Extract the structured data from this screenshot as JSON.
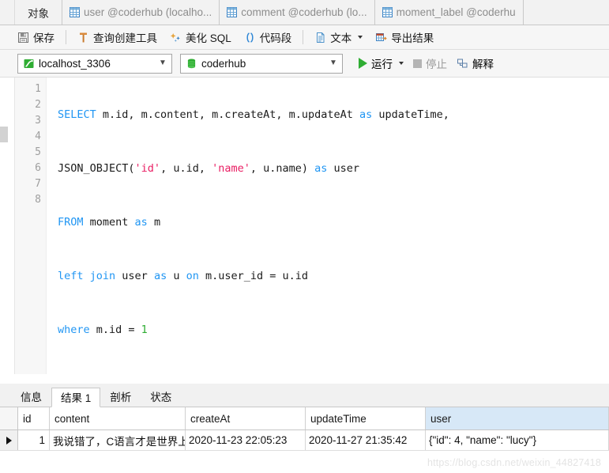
{
  "tabbar": {
    "object_label": "对象",
    "tabs": [
      {
        "icon": "table-grid-icon",
        "label": "user @coderhub (localho..."
      },
      {
        "icon": "table-grid-icon",
        "label": "comment @coderhub (lo..."
      },
      {
        "icon": "table-grid-icon",
        "label": "moment_label @coderhu"
      }
    ]
  },
  "toolbar": {
    "save_label": "保存",
    "query_builder_label": "查询创建工具",
    "beautify_label": "美化 SQL",
    "snippet_label": "代码段",
    "text_label": "文本",
    "export_label": "导出结果"
  },
  "connbar": {
    "connection_value": "localhost_3306",
    "database_value": "coderhub",
    "run_label": "运行",
    "stop_label": "停止",
    "explain_label": "解释"
  },
  "editor": {
    "line_numbers": [
      "1",
      "2",
      "3",
      "4",
      "5",
      "6",
      "7",
      "8"
    ],
    "lines": [
      {
        "n": 1,
        "text": "SELECT m.id, m.content, m.createAt, m.updateAt as updateTime,"
      },
      {
        "n": 2,
        "text": "JSON_OBJECT('id', u.id, 'name', u.name) as user"
      },
      {
        "n": 3,
        "text": "FROM moment as m"
      },
      {
        "n": 4,
        "text": "left join user as u on m.user_id = u.id"
      },
      {
        "n": 5,
        "text": "where m.id = 1"
      },
      {
        "n": 6,
        "text": ""
      },
      {
        "n": 7,
        "text": ""
      },
      {
        "n": 8,
        "text": ""
      }
    ],
    "tokens": {
      "l1_kw_select": "SELECT",
      "l1_mid": " m.id, m.content, m.createAt, m.updateAt ",
      "l1_kw_as": "as",
      "l1_end": " updateTime,",
      "l2_fn": "JSON_OBJECT(",
      "l2_s1": "'id'",
      "l2_m1": ", u.id, ",
      "l2_s2": "'name'",
      "l2_m2": ", u.name) ",
      "l2_kw_as": "as",
      "l2_end": " user",
      "l3_kw": "FROM",
      "l3_rest": " moment ",
      "l3_kw2": "as",
      "l3_end": " m",
      "l4_kw": "left join",
      "l4_m1": " user ",
      "l4_kw2": "as",
      "l4_m2": " u ",
      "l4_kw3": "on",
      "l4_end": " m.user_id = u.id",
      "l5_kw": "where",
      "l5_m": " m.id = ",
      "l5_num": "1"
    },
    "cursor_line": 8
  },
  "bottom_tabs": [
    {
      "label": "信息",
      "active": false
    },
    {
      "label": "结果 1",
      "active": true
    },
    {
      "label": "剖析",
      "active": false
    },
    {
      "label": "状态",
      "active": false
    }
  ],
  "result_grid": {
    "columns": [
      "id",
      "content",
      "createAt",
      "updateTime",
      "user"
    ],
    "selected_column": "user",
    "rows": [
      {
        "id": "1",
        "content": "我说错了，C语言才是世界上最好的语言",
        "createAt": "2020-11-23 22:05:23",
        "updateTime": "2020-11-27 21:35:42",
        "user": "{\"id\": 4, \"name\": \"lucy\"}"
      }
    ]
  },
  "watermark": "https://blog.csdn.net/weixin_44827418",
  "colors": {
    "keyword": "#2196f3",
    "string": "#e91e63",
    "number": "#2fad33",
    "run_green": "#2fad33",
    "selected_header": "#d7e8f7"
  }
}
